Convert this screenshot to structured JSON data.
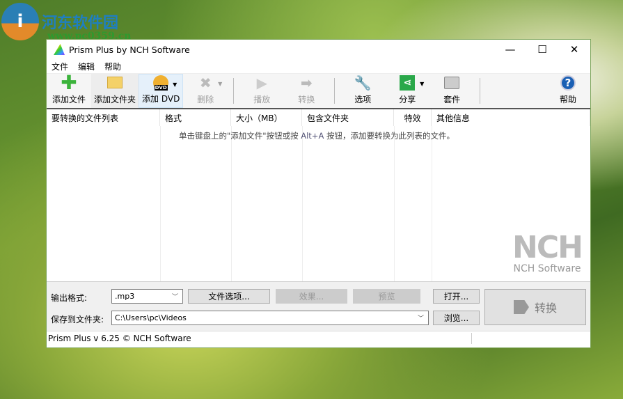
{
  "watermark": {
    "site_name": "河东软件园",
    "url": "www.pc0359.cn"
  },
  "window": {
    "title": "Prism Plus by NCH Software",
    "minimize": "—",
    "maximize": "☐",
    "close": "✕"
  },
  "menu": [
    "文件",
    "编辑",
    "帮助"
  ],
  "toolbar": {
    "add_file": "添加文件",
    "add_folder": "添加文件夹",
    "add_dvd": "添加 DVD",
    "dvd_badge": "DVD",
    "delete": "删除",
    "play": "播放",
    "convert": "转换",
    "options": "选项",
    "share": "分享",
    "suite": "套件",
    "help": "帮助"
  },
  "list": {
    "columns": [
      "要转换的文件列表",
      "格式",
      "大小（MB）",
      "包含文件夹",
      "特效",
      "其他信息"
    ],
    "hint_pre": "单击键盘上的\"添加文件\"按钮或按 ",
    "hint_key": "Alt+A",
    "hint_post": " 按钮，添加要转换为此列表的文件。",
    "brand_logo": "NCH",
    "brand_name": "NCH Software"
  },
  "bottom": {
    "output_format_label": "输出格式:",
    "output_format_value": ".mp3",
    "file_options": "文件选项...",
    "effects": "效果...",
    "preview": "预览",
    "open": "打开...",
    "save_label": "保存到文件夹:",
    "save_path": "C:\\Users\\pc\\Videos",
    "browse": "浏览...",
    "convert": "转换"
  },
  "status": {
    "text": "Prism Plus v 6.25 © NCH Software"
  }
}
